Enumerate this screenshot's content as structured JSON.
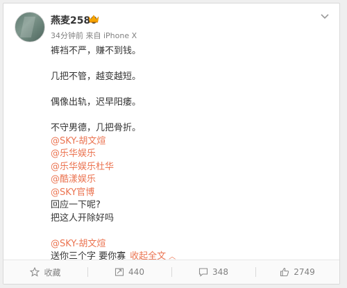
{
  "post": {
    "username": "燕麦2580",
    "meta": "34分钟前 来自 iPhone X",
    "lines_group1": [
      "裤裆不严，赚不到钱。"
    ],
    "lines_group2": [
      "几把不管，越变越短。"
    ],
    "lines_group3": [
      "偶像出轨，迟早阳痿。"
    ],
    "lines_group4": [
      "不守男德，几把骨折。"
    ],
    "mentions": [
      "@SKY-胡文煊",
      "@乐华娱乐",
      "@乐华娱乐杜华",
      "@酷漾娱乐",
      "@SKY官博"
    ],
    "lines_group5": [
      "回应一下呢?",
      "把这人开除好吗"
    ],
    "mention_final": "@SKY-胡文煊",
    "last_line": "送你三个字 要你寡",
    "collapse_label": "收起全文"
  },
  "actions": {
    "favorite": "收藏",
    "repost": "440",
    "comment": "348",
    "like": "2749"
  },
  "colors": {
    "link": "#eb7350",
    "text": "#333333",
    "meta": "#808080"
  },
  "icons": [
    "vip-crown-icon",
    "chevron-down-icon",
    "star-icon",
    "repost-icon",
    "comment-icon",
    "thumbs-up-icon"
  ]
}
